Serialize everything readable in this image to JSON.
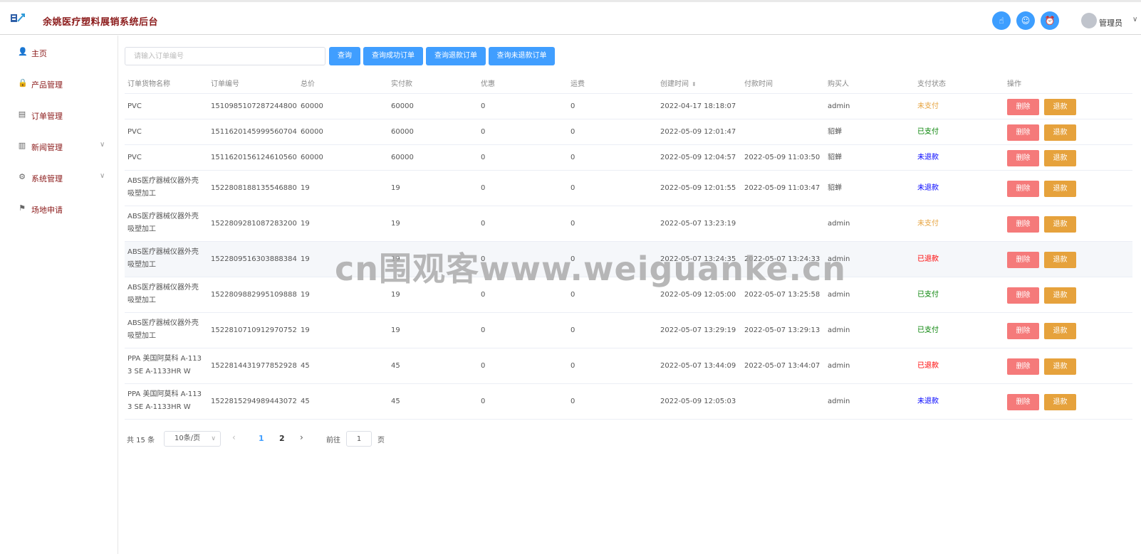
{
  "header": {
    "title": "余姚医疗塑料展销系统后台",
    "logo_icon": "logo-icon",
    "icons": [
      "hand-icon",
      "user-badge-icon",
      "alarm-clock-icon"
    ],
    "user": "管理员",
    "accent": "#409eff",
    "title_color": "#8b1a1a"
  },
  "sidebar": {
    "items": [
      {
        "label": "主页",
        "icon": "user-icon",
        "glyph": "👤",
        "expandable": false
      },
      {
        "label": "产品管理",
        "icon": "lock-icon",
        "glyph": "🔒",
        "expandable": false
      },
      {
        "label": "订单管理",
        "icon": "layers-icon",
        "glyph": "▤",
        "expandable": false
      },
      {
        "label": "新闻管理",
        "icon": "document-icon",
        "glyph": "▥",
        "expandable": true
      },
      {
        "label": "系统管理",
        "icon": "gear-icon",
        "glyph": "⚙",
        "expandable": true
      },
      {
        "label": "场地申请",
        "icon": "flag-icon",
        "glyph": "⚑",
        "expandable": false
      }
    ]
  },
  "search": {
    "placeholder": "请输入订单编号",
    "buttons": [
      "查询",
      "查询成功订单",
      "查询退款订单",
      "查询未退款订单"
    ]
  },
  "table": {
    "columns": [
      "订单货物名称",
      "订单编号",
      "总价",
      "实付款",
      "优惠",
      "运费",
      "创建时间",
      "付款时间",
      "购买人",
      "支付状态",
      "操作"
    ],
    "delete_label": "删除",
    "refund_label": "退款",
    "status_colors": {
      "未支付": "#e6a23c",
      "已支付": "#008000",
      "未退款": "#0000ff",
      "已退款": "#ff0000"
    },
    "rows": [
      {
        "name": [
          "PVC"
        ],
        "order_no": "1510985107287244800",
        "total": "60000",
        "paid": "60000",
        "discount": "0",
        "shipping": "0",
        "created": "2022-04-17 18:18:07",
        "pay_time": "",
        "buyer": "admin",
        "status": "未支付"
      },
      {
        "name": [
          "PVC"
        ],
        "order_no": "1511620145999560704",
        "total": "60000",
        "paid": "60000",
        "discount": "0",
        "shipping": "0",
        "created": "2022-05-09 12:01:47",
        "pay_time": "",
        "buyer": "貂蝉",
        "status": "已支付"
      },
      {
        "name": [
          "PVC"
        ],
        "order_no": "1511620156124610560",
        "total": "60000",
        "paid": "60000",
        "discount": "0",
        "shipping": "0",
        "created": "2022-05-09 12:04:57",
        "pay_time": "2022-05-09 11:03:50",
        "buyer": "貂蝉",
        "status": "未退款"
      },
      {
        "name": [
          "ABS医疗器械仪器外壳",
          "吸塑加工"
        ],
        "order_no": "1522808188135546880",
        "total": "19",
        "paid": "19",
        "discount": "0",
        "shipping": "0",
        "created": "2022-05-09 12:01:55",
        "pay_time": "2022-05-09 11:03:47",
        "buyer": "貂蝉",
        "status": "未退款"
      },
      {
        "name": [
          "ABS医疗器械仪器外壳",
          "吸塑加工"
        ],
        "order_no": "1522809281087283200",
        "total": "19",
        "paid": "19",
        "discount": "0",
        "shipping": "0",
        "created": "2022-05-07 13:23:19",
        "pay_time": "",
        "buyer": "admin",
        "status": "未支付"
      },
      {
        "name": [
          "ABS医疗器械仪器外壳",
          "吸塑加工"
        ],
        "order_no": "1522809516303888384",
        "total": "19",
        "paid": "19",
        "discount": "0",
        "shipping": "0",
        "created": "2022-05-07 13:24:35",
        "pay_time": "2022-05-07 13:24:33",
        "buyer": "admin",
        "status": "已退款"
      },
      {
        "name": [
          "ABS医疗器械仪器外壳",
          "吸塑加工"
        ],
        "order_no": "1522809882995109888",
        "total": "19",
        "paid": "19",
        "discount": "0",
        "shipping": "0",
        "created": "2022-05-09 12:05:00",
        "pay_time": "2022-05-07 13:25:58",
        "buyer": "admin",
        "status": "已支付"
      },
      {
        "name": [
          "ABS医疗器械仪器外壳",
          "吸塑加工"
        ],
        "order_no": "1522810710912970752",
        "total": "19",
        "paid": "19",
        "discount": "0",
        "shipping": "0",
        "created": "2022-05-07 13:29:19",
        "pay_time": "2022-05-07 13:29:13",
        "buyer": "admin",
        "status": "已支付"
      },
      {
        "name": [
          "PPA 美国阿莫科 A-113",
          "3 SE A-1133HR W"
        ],
        "order_no": "1522814431977852928",
        "total": "45",
        "paid": "45",
        "discount": "0",
        "shipping": "0",
        "created": "2022-05-07 13:44:09",
        "pay_time": "2022-05-07 13:44:07",
        "buyer": "admin",
        "status": "已退款"
      },
      {
        "name": [
          "PPA 美国阿莫科 A-113",
          "3 SE A-1133HR W"
        ],
        "order_no": "1522815294989443072",
        "total": "45",
        "paid": "45",
        "discount": "0",
        "shipping": "0",
        "created": "2022-05-09 12:05:03",
        "pay_time": "",
        "buyer": "admin",
        "status": "未退款"
      }
    ]
  },
  "pagination": {
    "total": "共 15 条",
    "page_size": "10条/页",
    "pages": [
      "1",
      "2"
    ],
    "current": "1",
    "goto_label": "前往",
    "goto_value": "1",
    "page_unit": "页"
  },
  "watermark": "cn围观客www.weiguanke.cn"
}
